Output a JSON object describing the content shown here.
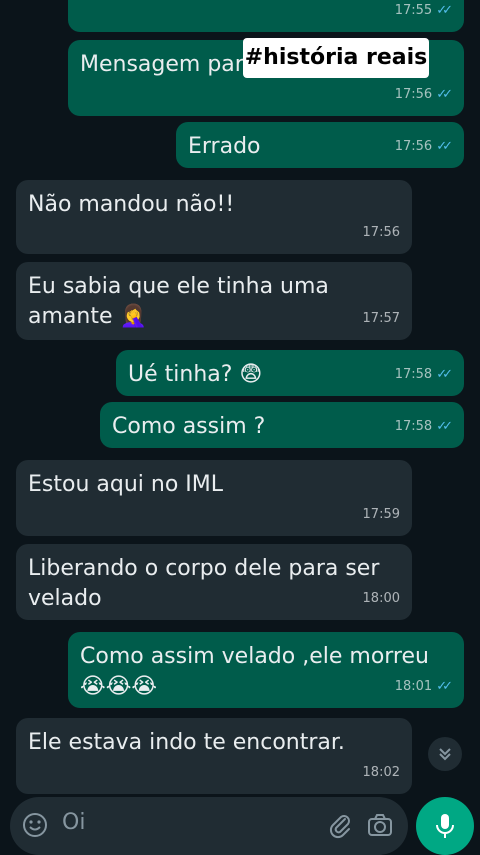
{
  "overlay": {
    "text": "#história reais"
  },
  "messages": [
    {
      "dir": "out",
      "text": "",
      "time": "17:55"
    },
    {
      "dir": "out",
      "text": "Mensagem par",
      "time": "17:56"
    },
    {
      "dir": "out",
      "text": "Errado",
      "time": "17:56"
    },
    {
      "dir": "in",
      "text": "Não mandou não!!",
      "time": "17:56"
    },
    {
      "dir": "in",
      "text": "Eu sabia que ele tinha uma",
      "text2": "amante 🤦‍♀️",
      "time": "17:57"
    },
    {
      "dir": "out",
      "text": "Ué tinha? 😨",
      "time": "17:58"
    },
    {
      "dir": "out",
      "text": "Como assim ?",
      "time": "17:58"
    },
    {
      "dir": "in",
      "text": "Estou aqui no IML",
      "time": "17:59"
    },
    {
      "dir": "in",
      "text": "Liberando o corpo dele para ser",
      "text2": "velado",
      "time": "18:00"
    },
    {
      "dir": "out",
      "text": "Como assim velado ,ele morreu",
      "text2": "😭😭😭",
      "time": "18:01"
    },
    {
      "dir": "in",
      "text": "Ele estava indo te encontrar.",
      "time": "18:02"
    }
  ],
  "composer": {
    "input_value": "Oi"
  },
  "icons": {
    "read_ticks": "double-check-icon",
    "scroll": "chevron-double-down-icon",
    "emoji": "emoji-icon",
    "attach": "paperclip-icon",
    "camera": "camera-icon",
    "mic": "microphone-icon"
  },
  "colors": {
    "background": "#0b141a",
    "outgoing": "#005c4b",
    "incoming": "#202c33",
    "read_tick": "#53bdeb",
    "mic": "#00a884"
  }
}
